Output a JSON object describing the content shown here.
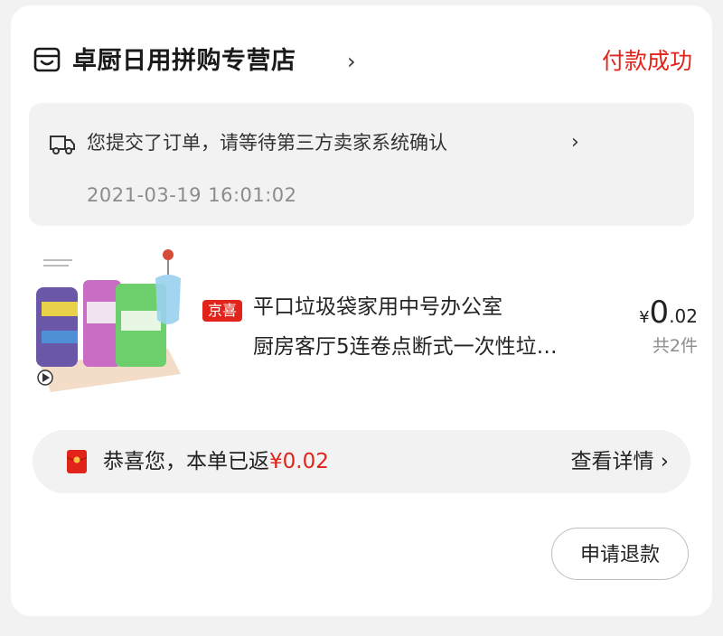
{
  "store": {
    "name": "卓厨日用拼购专营店",
    "chevron": "›",
    "status": "付款成功"
  },
  "notice": {
    "message": "您提交了订单，请等待第三方卖家系统确认",
    "chevron": "›",
    "time": "2021-03-19 16:01:02"
  },
  "product": {
    "badge": "京喜",
    "title_line1": "平口垃圾袋家用中号办公室",
    "title_line2": "厨房客厅5连卷点断式一次性垃…",
    "price_symbol": "¥",
    "price_int": "0",
    "price_dec": ".02",
    "quantity": "共2件",
    "thumb_icon": "garbage-bag-product-image"
  },
  "rebate": {
    "text": "恭喜您，本单已返",
    "amount": "¥0.02",
    "detail": "查看详情 ›",
    "icon": "red-envelope-icon"
  },
  "actions": {
    "refund": "申请退款"
  },
  "colors": {
    "accent": "#e2231a",
    "background": "#f2f2f2",
    "card": "#ffffff"
  }
}
